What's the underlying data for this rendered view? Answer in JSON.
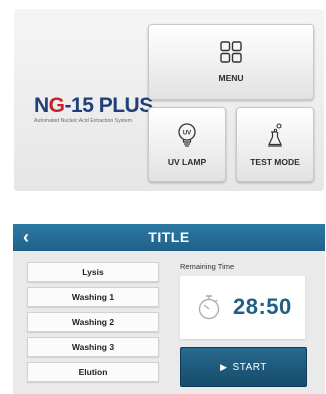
{
  "home": {
    "logo": {
      "part1": "N",
      "part2": "G",
      "part3": "-15 PLUS",
      "subtitle": "Automated Nucleic Acid Extraction System"
    },
    "tiles": {
      "menu": {
        "label": "MENU",
        "icon": "grid-menu-icon"
      },
      "uv_lamp": {
        "label": "UV LAMP",
        "icon": "lightbulb-icon"
      },
      "test_mode": {
        "label": "TEST MODE",
        "icon": "flask-icon"
      }
    }
  },
  "run": {
    "title": "TITLE",
    "back_label": "‹",
    "steps": [
      "Lysis",
      "Washing 1",
      "Washing 2",
      "Washing 3",
      "Elution"
    ],
    "remaining_label": "Remaining Time",
    "remaining_value": "28:50",
    "start_label": "START",
    "start_icon": "▶"
  },
  "colors": {
    "primary_blue": "#1f6189",
    "logo_blue": "#1e3f79",
    "logo_red": "#c8232c"
  }
}
